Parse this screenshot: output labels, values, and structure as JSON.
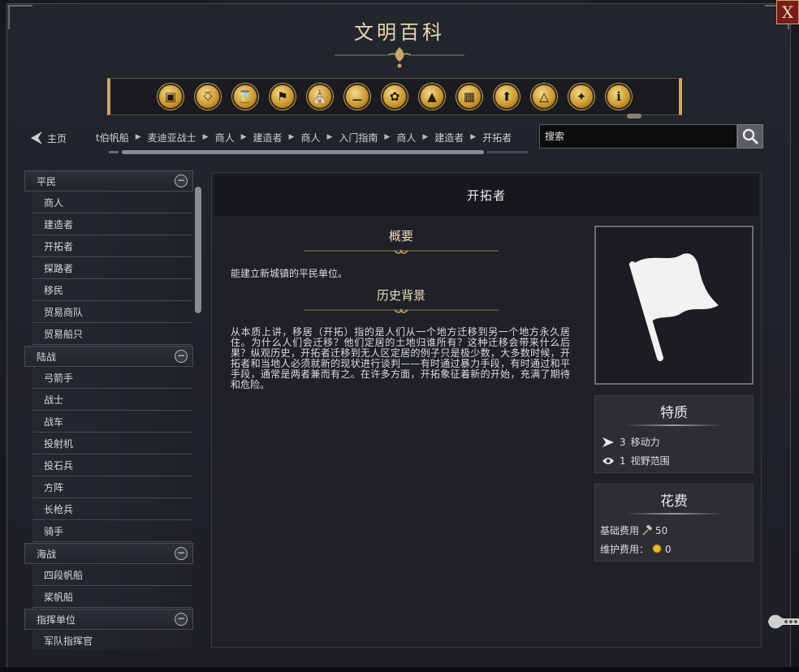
{
  "window": {
    "title": "文明百科",
    "close_label": "X"
  },
  "toolbar": {
    "icons": [
      "cube-icon",
      "pillar-icon",
      "hourglass-icon",
      "flag-icon",
      "temple-icon",
      "book-icon",
      "flower-icon",
      "mountain-icon",
      "building-icon",
      "arrow-up-icon",
      "pyramid-icon",
      "bird-icon",
      "info-icon"
    ]
  },
  "nav": {
    "home_label": "主页",
    "breadcrumb": [
      "t伯帆船",
      "麦迪亚战士",
      "商人",
      "建造者",
      "商人",
      "入门指南",
      "商人",
      "建造者",
      "开拓者"
    ],
    "search_placeholder": "搜索"
  },
  "sidebar": {
    "sections": [
      {
        "label": "平民",
        "items": [
          "商人",
          "建造者",
          "开拓者",
          "探路者",
          "移民",
          "贸易商队",
          "贸易船只"
        ]
      },
      {
        "label": "陆战",
        "items": [
          "弓箭手",
          "战士",
          "战车",
          "投射机",
          "投石兵",
          "方阵",
          "长枪兵",
          "骑手"
        ]
      },
      {
        "label": "海战",
        "items": [
          "四段帆船",
          "桨帆船"
        ]
      },
      {
        "label": "指挥单位",
        "items": [
          "军队指挥官"
        ]
      }
    ]
  },
  "main": {
    "heading": "开拓者",
    "overview_title": "概要",
    "overview_text": "能建立新城镇的平民单位。",
    "history_title": "历史背景",
    "history_text": "从本质上讲，移居（开拓）指的是人们从一个地方迁移到另一个地方永久居住。为什么人们会迁移？他们定居的土地归谁所有？这种迁移会带来什么后果？纵观历史，开拓者迁移到无人区定居的例子只是极少数，大多数时候，开拓者和当地人必须就新的现状进行谈判——有时通过暴力手段，有时通过和平手段，通常是两者兼而有之。在许多方面，开拓象征着新的开始，充满了期待和危险。",
    "unit_icon": "flag-icon"
  },
  "traits": {
    "title": "特质",
    "rows": [
      {
        "icon": "arrow-icon",
        "value": "3",
        "label": "移动力"
      },
      {
        "icon": "eye-icon",
        "value": "1",
        "label": "视野范围"
      }
    ]
  },
  "costs": {
    "title": "花费",
    "base_label": "基础费用",
    "base_value": "50",
    "upkeep_label": "维护费用：",
    "upkeep_value": "0"
  },
  "colors": {
    "accent_gold": "#c9a66b",
    "close_red": "#7a1b1b"
  }
}
